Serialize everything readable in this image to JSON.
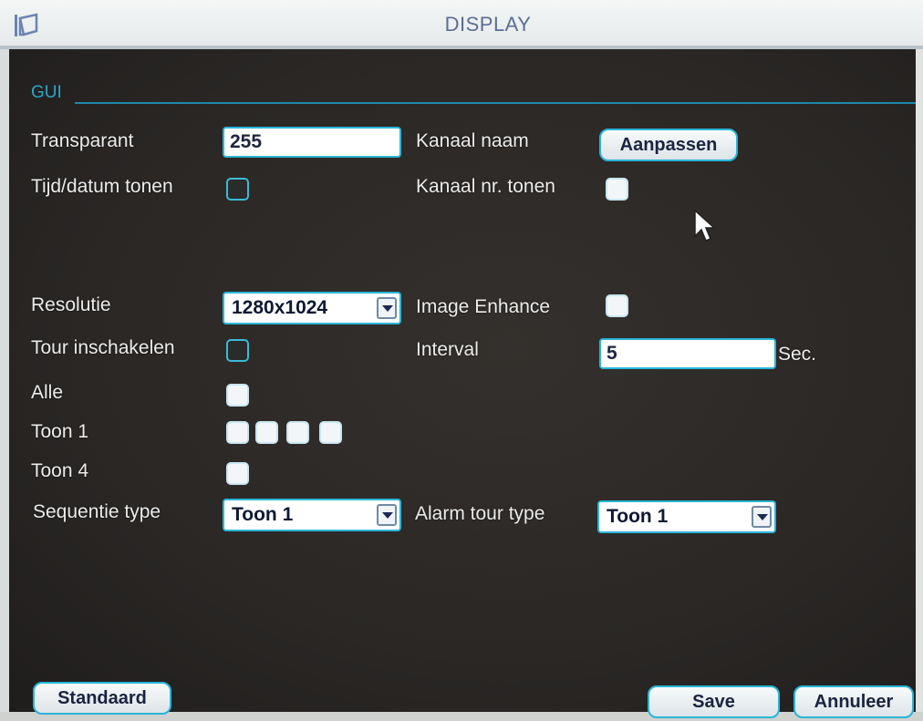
{
  "window": {
    "title": "DISPLAY",
    "icon": "window-icon"
  },
  "section": {
    "label": "GUI"
  },
  "fields": {
    "transparant": {
      "label": "Transparant",
      "value": "255"
    },
    "kanaal_naam": {
      "label": "Kanaal naam",
      "button": "Aanpassen"
    },
    "tijd_datum": {
      "label": "Tijd/datum tonen",
      "checked": false
    },
    "kanaal_nr": {
      "label": "Kanaal nr. tonen",
      "checked": true
    },
    "resolutie": {
      "label": "Resolutie",
      "value": "1280x1024"
    },
    "image_enhance": {
      "label": "Image Enhance",
      "checked": true
    },
    "tour": {
      "label": "Tour inschakelen",
      "checked": false
    },
    "interval": {
      "label": "Interval",
      "value": "5",
      "unit": "Sec."
    },
    "alle": {
      "label": "Alle",
      "checked": true
    },
    "toon1": {
      "label": "Toon 1",
      "count": 4,
      "checked": true
    },
    "toon4": {
      "label": "Toon 4",
      "checked": true
    },
    "sequentie": {
      "label": "Sequentie type",
      "value": "Toon 1"
    },
    "alarm_tour": {
      "label": "Alarm tour type",
      "value": "Toon 1"
    }
  },
  "footer": {
    "standaard": "Standaard",
    "save": "Save",
    "annuleer": "Annuleer"
  },
  "colors": {
    "accent": "#2ab5d8",
    "section": "#2aa6c9",
    "background": "#2a2826"
  }
}
